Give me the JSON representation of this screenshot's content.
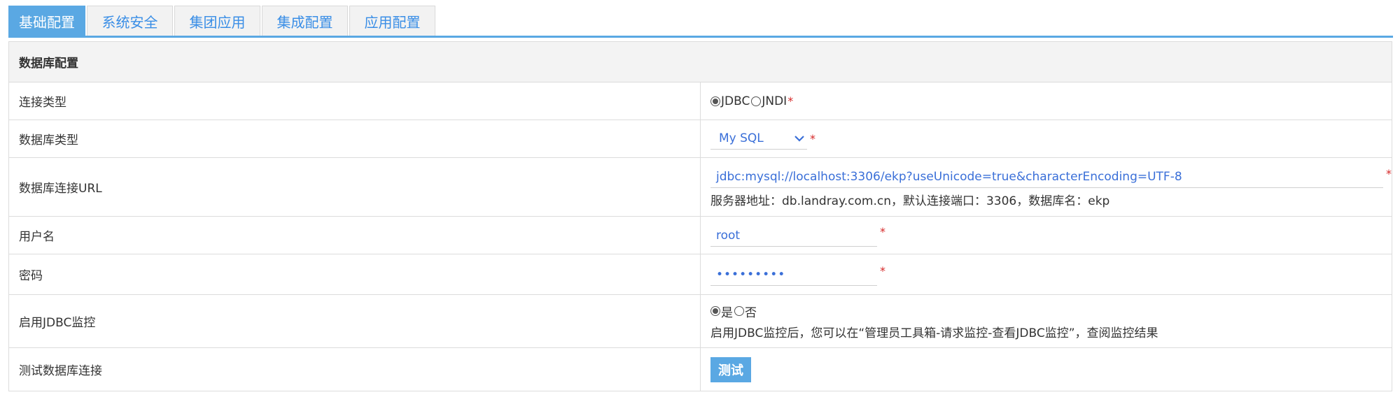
{
  "tabs": [
    {
      "label": "基础配置",
      "active": true
    },
    {
      "label": "系统安全",
      "active": false
    },
    {
      "label": "集团应用",
      "active": false
    },
    {
      "label": "集成配置",
      "active": false
    },
    {
      "label": "应用配置",
      "active": false
    }
  ],
  "section": {
    "title": "数据库配置"
  },
  "connection_type": {
    "label": "连接类型",
    "options": [
      {
        "label": "JDBC",
        "checked": true
      },
      {
        "label": "JNDI",
        "checked": false
      }
    ],
    "required_mark": "*"
  },
  "db_type": {
    "label": "数据库类型",
    "value": "My SQL",
    "required_mark": "*"
  },
  "db_url": {
    "label": "数据库连接URL",
    "value": "jdbc:mysql://localhost:3306/ekp?useUnicode=true&characterEncoding=UTF-8",
    "required_mark": "*",
    "hint": "服务器地址：db.landray.com.cn，默认连接端口：3306，数据库名：ekp"
  },
  "username": {
    "label": "用户名",
    "value": "root",
    "required_mark": "*"
  },
  "password": {
    "label": "密码",
    "value": "•••••••••",
    "required_mark": "*"
  },
  "jdbc_monitor": {
    "label": "启用JDBC监控",
    "options": [
      {
        "label": "是",
        "checked": true
      },
      {
        "label": "否",
        "checked": false
      }
    ],
    "hint": "启用JDBC监控后，您可以在“管理员工具箱-请求监控-查看JDBC监控”，查阅监控结果"
  },
  "test_connection": {
    "label": "测试数据库连接",
    "button": "测试"
  },
  "colors": {
    "accent": "#5aa8e3",
    "link": "#3a6fd8",
    "required": "#d62828"
  }
}
